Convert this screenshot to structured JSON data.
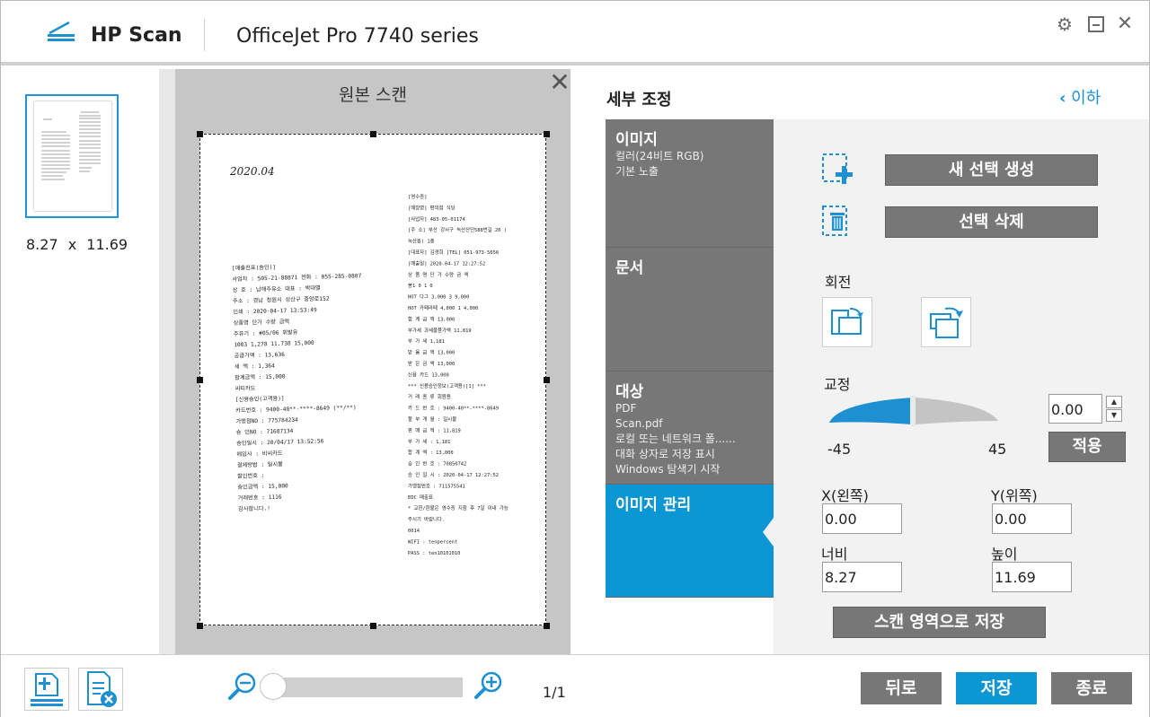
{
  "window": {
    "app_name": "HP Scan",
    "device": "OfficeJet Pro 7740 series",
    "controls": {
      "settings": "⚙",
      "minimize": "–",
      "close": "✕"
    }
  },
  "thumbnail": {
    "size_text": "8.27 x 11.69"
  },
  "preview": {
    "title": "원본 스캔",
    "close": "✕",
    "receipt": {
      "date_handwritten": "2020.04",
      "left_lines": [
        "[매출전표(승인)]",
        "사업자 : 505-21-88871  전화 : 055-285-0807",
        "상    호 : 남해주유소      대표 : 박대열",
        "주소 : 경남 창원시 성산구 중앙로152",
        "인쇄 : 2020-04-17  13:53:49",
        "상품명        단가        수량        금액",
        "주유기 : #05/06  휘발유",
        "1003         1,278      11.738      15,000",
        "공급가액 :                       13,636",
        "세    액 :                         1,364",
        "합계금액 :        15,000",
        "씨티카드",
        "[신용승인(고객용)]",
        "카드번호 : 9400-40**-****-8649 (**/**)",
        "가맹점NO : 775784234",
        "승    인NO : 71687134",
        "승인일시 : 20/04/17 13:52:56",
        "매입사 : 비씨카드",
        "결제방법 : 일시불",
        "할인번호 :",
        "승인금액 :          15,000",
        "거래번호 : 1116",
        "감사합니다.!"
      ],
      "right_lines": [
        "[영수증]",
        "[매장명] 편의점 식당",
        "[사업자] 483-05-01174",
        "[주 소] 부산 강서구 녹산산단588번길 20 (",
        "녹산동) 1층",
        "[대표자] 김경희         [TEL] 051-973-5656",
        "[매출일] 2020-04-17 12:27:52",
        "상 품 명        단 가    수량      금 액",
        "봉1                 0        1          0",
        "HOT 다그       3,000     3       9,000",
        "HOT 카페라떼   4,000     1       4,000",
        "합 계 금 액                        13,000",
        "부가세 과세물품가액            11,819",
        "부    가    세                       1,181",
        "받 을 금 액                    13,000",
        "받 은 금 액                    13,000",
        "신용 카드                         13,000",
        "*** 신용승인정보(고객용)[1] ***",
        "거 래 종 류                        회원용",
        "카 드 번 호 : 9400-40**-****-8649",
        "할 부 개 월 : 일시불",
        "판 매 금 액 :                     11,819",
        "부  가  세 :                        1,181",
        "합  계  액 :                      13,000",
        "승 인 번 호 : 70850742",
        "승 인 일 시 : 2020-04-17 12:27:52",
        "가맹점번호 : 711575541",
        "EDC 매출표",
        "* 교환/환불은 영수증 지참 후 7일 이내 가능",
        "  주시기 바랍니다.",
        "0014",
        "WIFI : tenpercent",
        "PASS : ten10101010"
      ]
    }
  },
  "detail": {
    "header": "세부 조정",
    "back_label": "이하",
    "tabs": [
      {
        "title": "이미지",
        "lines": [
          "컬러(24비트 RGB)",
          "기본 노출"
        ]
      },
      {
        "title": "문서",
        "lines": []
      },
      {
        "title": "대상",
        "lines": [
          "PDF",
          "Scan.pdf",
          "로컬 또는 네트워크 폴......",
          "대화 상자로 저장 표시",
          "Windows 탐색기 시작"
        ]
      },
      {
        "title": "이미지 관리",
        "lines": []
      }
    ],
    "new_selection_button": "새 선택 생성",
    "delete_selection_button": "선택 삭제",
    "rotate_label": "회전",
    "straighten_label": "교정",
    "straighten_min": "-45",
    "straighten_max": "45",
    "straighten_value": "0.00",
    "straighten_level": 0.0,
    "apply_button": "적용",
    "x_label": "X(왼쪽)",
    "x_value": "0.00",
    "y_label": "Y(위쪽)",
    "y_value": "0.00",
    "width_label": "너비",
    "width_value": "8.27",
    "height_label": "높이",
    "height_value": "11.69",
    "save_area_button": "스캔 영역으로 저장"
  },
  "bottom": {
    "page_count": "1/1",
    "zoom_level": 0.0,
    "back_button": "뒤로",
    "save_button": "저장",
    "exit_button": "종료"
  },
  "colors": {
    "accent": "#0d96d4",
    "tab_gray": "#777777",
    "panel_bg": "#f2f2f2"
  }
}
